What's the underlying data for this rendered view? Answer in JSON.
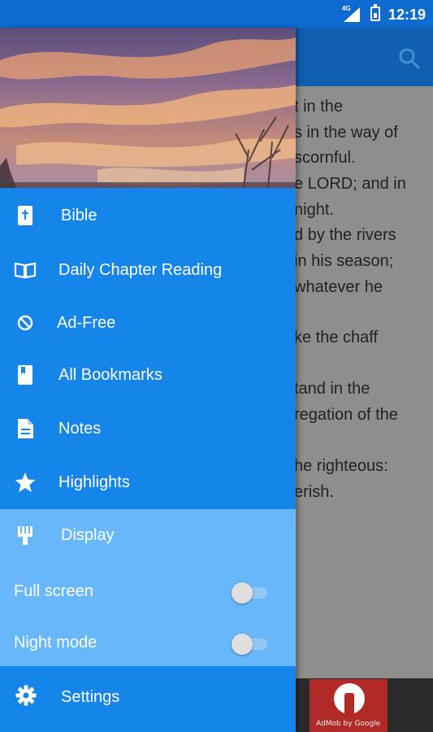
{
  "status_bar": {
    "network": "4G",
    "time": "12:19"
  },
  "reader": {
    "visible_text_lines": [
      "t in the",
      "s in the way of",
      "scornful.",
      "e LORD; and in",
      "night.",
      "d by the rivers",
      "in his season;",
      "whatever he",
      "ke the chaff",
      "tand in the",
      "regation of the",
      "he righteous:",
      "erish."
    ]
  },
  "drawer": {
    "items": [
      {
        "icon": "bible-book-icon",
        "label": "Bible"
      },
      {
        "icon": "open-book-icon",
        "label": "Daily Chapter Reading"
      },
      {
        "icon": "block-icon",
        "label": "Ad-Free"
      },
      {
        "icon": "bookmark-book-icon",
        "label": "All Bookmarks"
      },
      {
        "icon": "note-document-icon",
        "label": "Notes"
      },
      {
        "icon": "star-icon",
        "label": "Highlights"
      }
    ],
    "display": {
      "icon": "paint-brush-icon",
      "label": "Display",
      "full_screen": {
        "label": "Full screen",
        "on": false
      },
      "night_mode": {
        "label": "Night mode",
        "on": false
      }
    },
    "settings": {
      "icon": "gear-icon",
      "label": "Settings"
    }
  },
  "ad": {
    "caption": "AdMob by Google"
  },
  "colors": {
    "status_bar": "#0d6bd0",
    "drawer": "#1585e9",
    "display_panel": "#68b7fb",
    "reader_dimmed": "#8e8e8e"
  }
}
